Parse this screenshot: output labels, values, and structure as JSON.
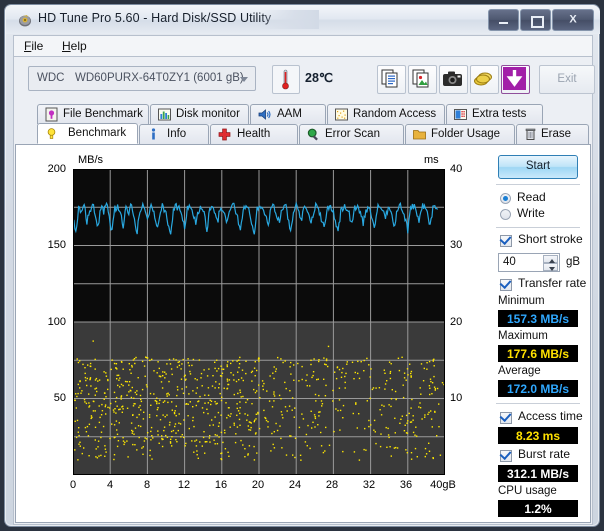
{
  "window": {
    "title": "HD Tune Pro 5.60 - Hard Disk/SSD Utility",
    "icon": "hdtune-app-icon",
    "minimize_label": "–",
    "maximize_label": "□",
    "close_label": "X"
  },
  "menu": {
    "items": [
      {
        "label": "File",
        "accel": "F"
      },
      {
        "label": "Help",
        "accel": "H"
      }
    ]
  },
  "toolbar": {
    "drive_vendor": "WDC",
    "drive_model": "WD60PURX-64T0ZY1 (6001 gB)",
    "temperature": "28℃",
    "thermometer_icon": "thermometer-icon",
    "buttons": [
      {
        "name": "copy-text-icon"
      },
      {
        "name": "copy-image-icon"
      },
      {
        "name": "screenshot-camera-icon"
      },
      {
        "name": "coins-icon"
      },
      {
        "name": "download-arrow-icon"
      }
    ],
    "exit_label": "Exit"
  },
  "tabs": {
    "top_row": [
      {
        "label": "File Benchmark",
        "icon": "file-benchmark-icon",
        "active": false
      },
      {
        "label": "Disk monitor",
        "icon": "disk-monitor-icon",
        "active": false
      },
      {
        "label": "AAM",
        "icon": "speaker-icon",
        "active": false
      },
      {
        "label": "Random Access",
        "icon": "random-access-icon",
        "active": false
      },
      {
        "label": "Extra tests",
        "icon": "extra-tests-icon",
        "active": false
      }
    ],
    "bottom_row": [
      {
        "label": "Benchmark",
        "icon": "lightbulb-icon",
        "active": true
      },
      {
        "label": "Info",
        "icon": "info-icon",
        "active": false
      },
      {
        "label": "Health",
        "icon": "health-cross-icon",
        "active": false
      },
      {
        "label": "Error Scan",
        "icon": "magnifier-icon",
        "active": false
      },
      {
        "label": "Folder Usage",
        "icon": "folder-icon",
        "active": false
      },
      {
        "label": "Erase",
        "icon": "trash-icon",
        "active": false
      }
    ]
  },
  "side_panel": {
    "start_label": "Start",
    "mode": {
      "read_label": "Read",
      "write_label": "Write",
      "selected": "Read"
    },
    "short_stroke": {
      "label": "Short stroke",
      "checked": true,
      "value": "40",
      "unit": "gB"
    },
    "transfer_rate": {
      "label": "Transfer rate",
      "checked": true,
      "minimum_label": "Minimum",
      "minimum_value": "157.3 MB/s",
      "maximum_label": "Maximum",
      "maximum_value": "177.6 MB/s",
      "average_label": "Average",
      "average_value": "172.0 MB/s"
    },
    "access_time": {
      "label": "Access time",
      "checked": true,
      "value": "8.23 ms"
    },
    "burst_rate": {
      "label": "Burst rate",
      "checked": true,
      "value": "312.1 MB/s"
    },
    "cpu_usage": {
      "label": "CPU usage",
      "value": "1.2%"
    }
  },
  "chart_data": {
    "type": "line",
    "title": "",
    "xlabel": "gB",
    "ylabel": "MB/s",
    "y2label": "ms",
    "xlim": [
      0,
      40
    ],
    "ylim": [
      0,
      200
    ],
    "y2lim": [
      0,
      40
    ],
    "grid": true,
    "legend_position": "none",
    "y_unit_label": "MB/s",
    "y2_unit_label": "ms",
    "x_unit_label": "gB",
    "y_ticks": [
      200,
      150,
      100,
      50
    ],
    "y2_ticks": [
      40,
      30,
      20,
      10
    ],
    "x_ticks": [
      0,
      4,
      8,
      12,
      16,
      20,
      24,
      28,
      32,
      36,
      40
    ],
    "x_last_tick_label": "40gB",
    "series": [
      {
        "name": "Transfer rate",
        "type": "line",
        "color": "#29a8e0",
        "axis": "left",
        "unit": "MB/s",
        "x": [
          0.0,
          0.3,
          0.6,
          0.9,
          1.2,
          1.5,
          1.8,
          2.1,
          2.4,
          2.7,
          3.0,
          3.3,
          3.6,
          3.9,
          4.2,
          4.5,
          4.8,
          5.1,
          5.4,
          5.7,
          6.0,
          6.3,
          6.6,
          6.9,
          7.2,
          7.5,
          7.8,
          8.1,
          8.4,
          8.7,
          9.0,
          9.3,
          9.6,
          9.9,
          10.2,
          10.5,
          10.8,
          11.1,
          11.4,
          11.7,
          12.0,
          12.3,
          12.6,
          12.9,
          13.2,
          13.5,
          13.8,
          14.1,
          14.4,
          14.7,
          15.0,
          15.3,
          15.6,
          15.9,
          16.2,
          16.5,
          16.8,
          17.1,
          17.4,
          17.7,
          18.0,
          18.3,
          18.6,
          18.9,
          19.2,
          19.5,
          19.8,
          20.1,
          20.4,
          20.7,
          21.0,
          21.3,
          21.6,
          21.9,
          22.2,
          22.5,
          22.8,
          23.1,
          23.4,
          23.7,
          24.0,
          24.3,
          24.6,
          24.9,
          25.2,
          25.5,
          25.8,
          26.1,
          26.4,
          26.7,
          27.0,
          27.3,
          27.6,
          27.9,
          28.2,
          28.5,
          28.8,
          29.1,
          29.4,
          29.7,
          30.0,
          30.3,
          30.6,
          30.9,
          31.2,
          31.5,
          31.8,
          32.1,
          32.4,
          32.7,
          33.0,
          33.3,
          33.6,
          33.9,
          34.2,
          34.5,
          34.8,
          35.1,
          35.4,
          35.7,
          36.0,
          36.3,
          36.6,
          36.9,
          37.2,
          37.5,
          37.8,
          38.1,
          38.4,
          38.7,
          39.0,
          39.3,
          39.6,
          39.9
        ],
        "values": [
          167.0,
          158.0,
          174.0,
          170.0,
          176.0,
          166.0,
          173.0,
          176.0,
          171.0,
          161.0,
          175.0,
          172.0,
          177.0,
          168.0,
          160.0,
          174.0,
          176.0,
          170.0,
          163.0,
          175.0,
          172.0,
          177.0,
          166.0,
          159.0,
          173.0,
          176.0,
          171.0,
          168.0,
          176.0,
          174.0,
          162.0,
          170.0,
          177.0,
          173.0,
          165.0,
          158.0,
          172.0,
          176.0,
          174.0,
          169.0,
          161.0,
          175.0,
          177.0,
          171.0,
          164.0,
          173.0,
          176.0,
          170.0,
          159.0,
          174.0,
          177.0,
          172.0,
          167.0,
          176.0,
          173.0,
          163.0,
          171.0,
          177.0,
          175.0,
          168.0,
          160.0,
          174.0,
          176.0,
          172.0,
          166.0,
          158.0,
          173.0,
          177.0,
          174.0,
          170.0,
          162.0,
          175.0,
          176.0,
          171.0,
          165.0,
          174.0,
          177.0,
          169.0,
          159.0,
          173.0,
          176.0,
          172.0,
          168.0,
          177.0,
          174.0,
          164.0,
          170.0,
          176.0,
          175.0,
          167.0,
          161.0,
          174.0,
          177.0,
          173.0,
          166.0,
          158.0,
          172.0,
          176.0,
          174.0,
          170.0,
          163.0,
          175.0,
          177.0,
          171.0,
          165.0,
          173.0,
          176.0,
          169.0,
          160.0,
          174.0,
          177.0,
          172.0,
          167.0,
          176.0,
          174.0,
          162.0,
          171.0,
          177.0,
          175.0,
          168.0,
          159.0,
          173.0,
          176.0,
          172.0,
          166.0,
          175.0,
          177.0,
          170.0,
          163.0,
          174.0,
          176.0,
          171.0
        ],
        "minimum": 157.3,
        "maximum": 177.6,
        "average": 172.0
      },
      {
        "name": "Access time",
        "type": "scatter",
        "color": "#ffe800",
        "axis": "right",
        "unit": "ms",
        "average": 8.23,
        "point_range_ms": [
          2.0,
          15.5
        ],
        "density_note": "dense cluster 0-20 gB, sparser 20-40 gB"
      }
    ]
  }
}
